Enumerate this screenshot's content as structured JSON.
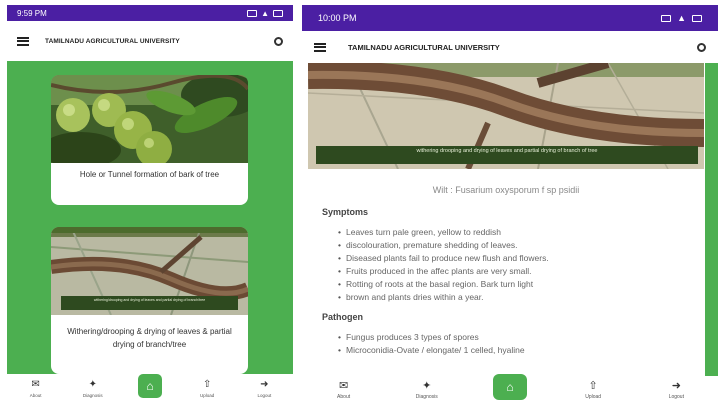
{
  "screen1": {
    "status_time": "9:59 PM",
    "app_title": "TAMILNADU AGRICULTURAL UNIVERSITY",
    "cards": [
      {
        "title": "Hole or Tunnel formation of bark of tree"
      },
      {
        "title": "Withering/drooping & drying of leaves & partial drying of branch/tree",
        "image_caption": "withering/drooping and drying of leaves and partial drying of branch/tree"
      }
    ],
    "nav": [
      {
        "label": "About",
        "icon": "mail-icon"
      },
      {
        "label": "Diagnosis",
        "icon": "sprout-icon"
      },
      {
        "label": "",
        "icon": "home-icon"
      },
      {
        "label": "Upload",
        "icon": "upload-icon"
      },
      {
        "label": "Logout",
        "icon": "logout-icon"
      }
    ]
  },
  "screen2": {
    "status_time": "10:00 PM",
    "app_title": "TAMILNADU AGRICULTURAL UNIVERSITY",
    "image_caption": "withering drooping and drying of leaves and partial drying of branch of tree",
    "disease": "Wilt : Fusarium oxysporum f sp psidii",
    "symptoms_heading": "Symptoms",
    "symptoms": [
      "Leaves turn pale green, yellow to reddish",
      "discolouration, premature shedding of leaves.",
      "Diseased plants fail to produce new flush and flowers.",
      "Fruits produced in the affec plants are very small.",
      "Rotting of roots at the basal region. Bark turn light",
      "brown and plants dries within a year."
    ],
    "pathogen_heading": "Pathogen",
    "pathogen": [
      "Fungus produces 3 types of spores",
      "Microconidia-Ovate / elongate/ 1 celled, hyaline"
    ],
    "nav": [
      {
        "label": "About",
        "icon": "mail-icon"
      },
      {
        "label": "Diagnosis",
        "icon": "sprout-icon"
      },
      {
        "label": "",
        "icon": "home-icon"
      },
      {
        "label": "Upload",
        "icon": "upload-icon"
      },
      {
        "label": "Logout",
        "icon": "logout-icon"
      }
    ]
  },
  "colors": {
    "status_bar": "#4b1fa3",
    "accent_green": "#4caf50",
    "caption_bg": "#2e4a1f"
  }
}
